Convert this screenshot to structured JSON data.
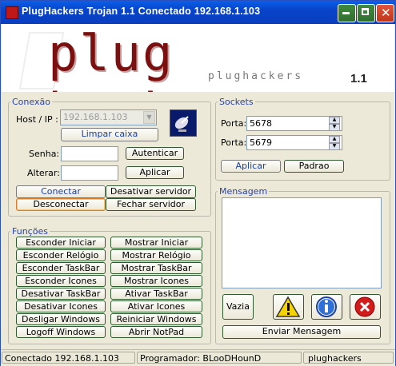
{
  "window": {
    "title": "PlugHackers Trojan 1.1  Conectado 192.168.1.103"
  },
  "banner": {
    "logo": "plug hackers",
    "sub": "plughackers",
    "version": "1.1"
  },
  "conexao": {
    "legend": "Conexão",
    "host_label": "Host / IP :",
    "host_value": "192.168.1.103",
    "limpar": "Limpar caixa",
    "senha_label": "Senha:",
    "autenticar": "Autenticar",
    "alterar_label": "Alterar:",
    "aplicar": "Aplicar",
    "conectar": "Conectar",
    "desativar_servidor": "Desativar servidor",
    "desconectar": "Desconectar",
    "fechar_servidor": "Fechar servidor"
  },
  "sockets": {
    "legend": "Sockets",
    "porta_label": "Porta:",
    "porta1": "5678",
    "porta2": "5679",
    "aplicar": "Aplicar",
    "padrao": "Padrao"
  },
  "funcoes": {
    "legend": "Funções",
    "left": [
      "Esconder Iniciar",
      "Esconder Relógio",
      "Esconder TaskBar",
      "Esconder Icones",
      "Desativar TaskBar",
      "Desativar Icones",
      "Desligar Windows",
      "Logoff Windows"
    ],
    "right": [
      "Mostrar Iniciar",
      "Mostrar Relógio",
      "Mostrar TaskBar",
      "Mostrar Icones",
      "Ativar TaskBar",
      "Ativar Icones",
      "Reiniciar Windows",
      "Abrir NotPad"
    ]
  },
  "mensagem": {
    "legend": "Mensagem",
    "vazia": "Vazia",
    "enviar": "Enviar Mensagem",
    "icons": [
      "warning-icon",
      "info-icon",
      "error-icon"
    ]
  },
  "status": {
    "seg1": "Conectado 192.168.1.103",
    "seg2": "Programador: BLooDHounD",
    "seg3": "plughackers"
  }
}
